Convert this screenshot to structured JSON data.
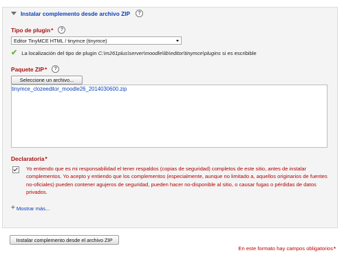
{
  "section": {
    "title": "Instalar complemento desde archivo ZIP"
  },
  "plugin_type": {
    "label": "Tipo de plugin",
    "required_mark": "*",
    "selected": "Editor TinyMCE HTML / tinymce (tinymce)"
  },
  "location_check": {
    "prefix": "La localización del tipo de plugin",
    "path": "C:\\m261plus\\server\\moodle\\lib\\editor\\tinymce\\plugins",
    "suffix": "si es escribible"
  },
  "package": {
    "label": "Paquete ZIP",
    "required_mark": "*",
    "select_button": "Seleccione un archivo...",
    "filename": "tinymce_clozeeditor_moodle26_2014030600.zip"
  },
  "declaration": {
    "label": "Declaratoria",
    "required_mark": "*",
    "checked": true,
    "text": "Yo entiendo que es mi responsabilidad el tener respaldos (copias de seguridad) completos de este sitio, antes de instalar complementos. Yo acepto y entiendo que los complementos (especialmente, aunque no limitado a, aquellos originarios de fuentes no-oficiales) pueden contener agujeros de seguridad, pueden hacer no-disponible al sitio, o causar fugas o pérdidas de datos privados."
  },
  "show_more": "Mostrar más...",
  "install_button": "Instalar complemento desde el archivo ZIP",
  "footer_note": {
    "text": "En este formato hay campos obligatorios",
    "mark": "*"
  },
  "icons": {
    "collapse": "triangle-down-icon",
    "help": "question-circle-icon",
    "check": "green-check-icon",
    "expand": "plus-icon"
  },
  "colors": {
    "link": "#0a3fb8",
    "required": "#cc0000",
    "label": "#aa1111",
    "success": "#6db33f",
    "fieldset_bg": "#f4f4f4"
  }
}
